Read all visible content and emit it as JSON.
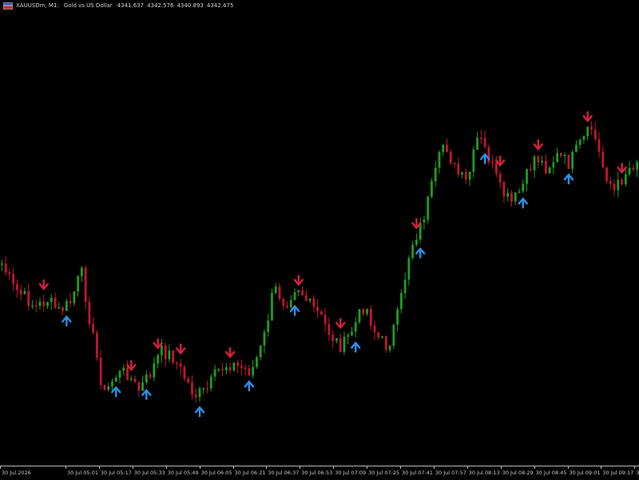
{
  "window": {
    "symbol": "XAUUSDm, M1:",
    "description": "Gold vs US Dollar",
    "ohlc": [
      "4341.637",
      "4342.576",
      "4340.893",
      "4342.475"
    ]
  },
  "colors": {
    "background": "#000000",
    "bull": "#1e9e1e",
    "bear": "#c2162e",
    "buy_arrow": "#2f8fe8",
    "sell_arrow": "#d5203f",
    "axis_text": "#c8c8c8"
  },
  "x_axis": {
    "labels": [
      "30 Jul 2026",
      "30 Jul 05:01",
      "30 Jul 05:17",
      "30 Jul 05:33",
      "30 Jul 05:49",
      "30 Jul 06:05",
      "30 Jul 06:21",
      "30 Jul 06:37",
      "30 Jul 06:53",
      "30 Jul 07:09",
      "30 Jul 07:25",
      "30 Jul 07:41",
      "30 Jul 07:57",
      "30 Jul 08:13",
      "30 Jul 08:29",
      "30 Jul 08:45",
      "30 Jul 09:01",
      "30 Jul 09:17",
      "30 Jul 09:33"
    ]
  },
  "chart_data": {
    "type": "candlestick",
    "timeframe": "M1",
    "closes_level_path": [
      330,
      360,
      372,
      385,
      375,
      390,
      380,
      340,
      420,
      495,
      470,
      465,
      490,
      470,
      440,
      445,
      470,
      495,
      490,
      465,
      455,
      460,
      465,
      430,
      360,
      380,
      355,
      380,
      395,
      420,
      435,
      410,
      380,
      420,
      435,
      390,
      310,
      280,
      230,
      175,
      215,
      230,
      170,
      200,
      240,
      255,
      230,
      195,
      210,
      195,
      205,
      180,
      160,
      210,
      240,
      215,
      200
    ],
    "buy_signals_candle_index": [
      17,
      30,
      38,
      52,
      65,
      77,
      93,
      110,
      127,
      137,
      149
    ],
    "sell_signals_candle_index": [
      11,
      34,
      41,
      47,
      60,
      78,
      89,
      109,
      131,
      141,
      154,
      163
    ]
  }
}
